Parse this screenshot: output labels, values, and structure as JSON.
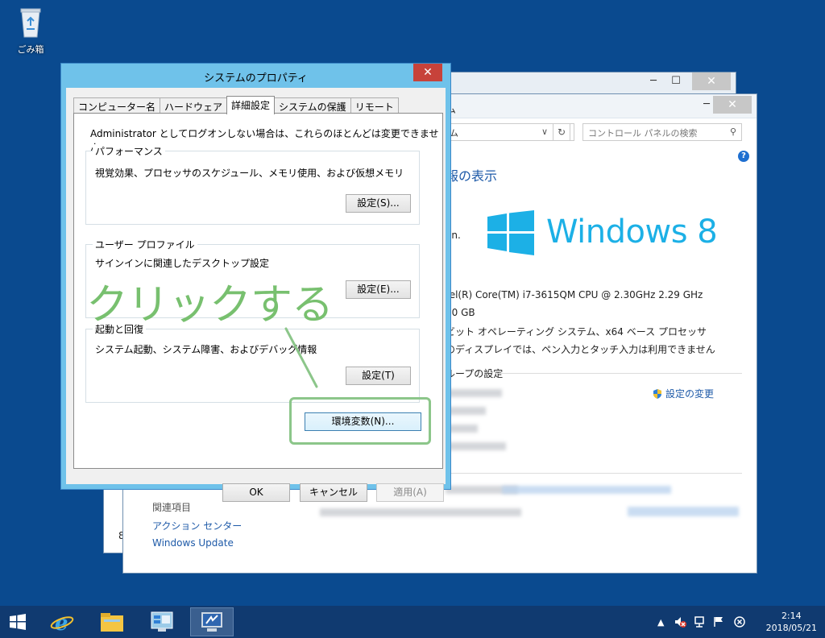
{
  "desktop": {
    "recycle_bin_label": "ごみ箱"
  },
  "background_window": {
    "title_fragment": "ム",
    "address_fragment": "ム",
    "search_placeholder": "コントロール パネルの検索",
    "heading_fragment": "報の表示",
    "windows_logo_text": "Windows 8",
    "copyright_fragment": "on.",
    "processor": "tel(R) Core(TM) i7-3615QM CPU @ 2.30GHz   2.29 GHz",
    "memory": "00 GB",
    "system_type": "ビット オペレーティング システム、x64 ベース プロセッサ",
    "pen_touch": "のディスプレイでは、ペン入力とタッチ入力は利用できません",
    "workgroup_section": "ループの設定",
    "change_settings_link": "設定の変更",
    "related_heading": "関連項目",
    "related_links": [
      "アクション センター",
      "Windows Update"
    ],
    "side_fragment": "8"
  },
  "dialog": {
    "title": "システムのプロパティ",
    "tabs": [
      {
        "label": "コンピューター名"
      },
      {
        "label": "ハードウェア"
      },
      {
        "label": "詳細設定"
      },
      {
        "label": "システムの保護"
      },
      {
        "label": "リモート"
      }
    ],
    "admin_message": "Administrator としてログオンしない場合は、これらのほとんどは変更できません。",
    "performance": {
      "title": "パフォーマンス",
      "description": "視覚効果、プロセッサのスケジュール、メモリ使用、および仮想メモリ",
      "button": "設定(S)..."
    },
    "user_profile": {
      "title": "ユーザー プロファイル",
      "description": "サインインに関連したデスクトップ設定",
      "button": "設定(E)..."
    },
    "startup_recovery": {
      "title": "起動と回復",
      "description": "システム起動、システム障害、およびデバッグ情報",
      "button": "設定(T)"
    },
    "env_vars_button": "環境変数(N)...",
    "ok_button": "OK",
    "cancel_button": "キャンセル",
    "apply_button": "適用(A)"
  },
  "annotation": {
    "text": "クリックする"
  },
  "taskbar": {
    "time": "2:14",
    "date": "2018/05/21"
  },
  "colors": {
    "accent": "#6fc2ea",
    "annotation": "#78c06f",
    "desktop": "#0a4a8f"
  }
}
